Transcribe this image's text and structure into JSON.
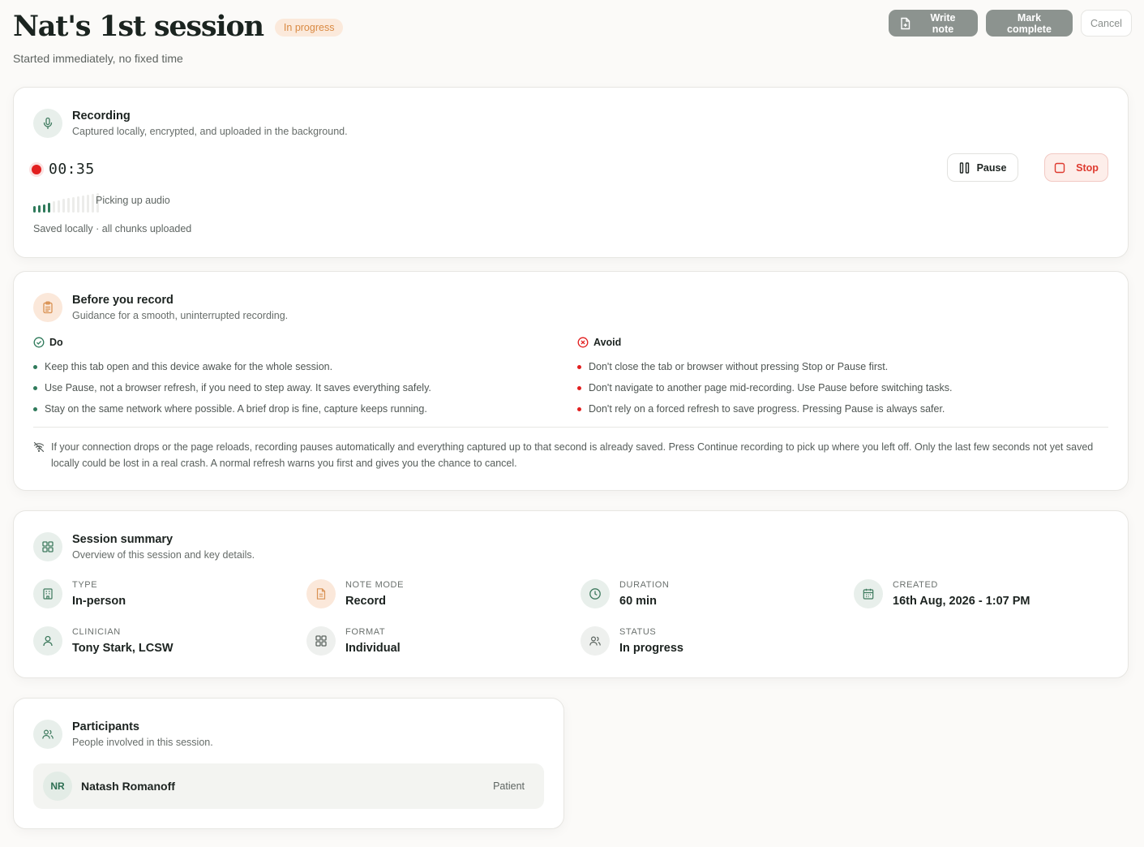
{
  "header": {
    "title": "Nat's 1st session",
    "status": "In progress",
    "subtitle": "Started immediately, no fixed time",
    "write_note": "Write note",
    "mark_complete": "Mark complete",
    "cancel": "Cancel"
  },
  "recording": {
    "title": "Recording",
    "subtitle": "Captured locally, encrypted, and uploaded in the background.",
    "time": "00:35",
    "level_label": "Picking up audio",
    "audio_level_bars_lit": 4,
    "audio_level_bars_total": 14,
    "saved_text": "Saved locally · all chunks uploaded",
    "pause": "Pause",
    "stop": "Stop"
  },
  "guidance": {
    "title": "Before you record",
    "subtitle": "Guidance for a smooth, uninterrupted recording.",
    "do_heading": "Do",
    "do_items": [
      "Keep this tab open and this device awake for the whole session.",
      "Use Pause, not a browser refresh, if you need to step away. It saves everything safely.",
      "Stay on the same network where possible. A brief drop is fine, capture keeps running."
    ],
    "avoid_heading": "Avoid",
    "avoid_items": [
      "Don't close the tab or browser without pressing Stop or Pause first.",
      "Don't navigate to another page mid-recording. Use Pause before switching tasks.",
      "Don't rely on a forced refresh to save progress. Pressing Pause is always safer."
    ],
    "note": "If your connection drops or the page reloads, recording pauses automatically and everything captured up to that second is already saved. Press Continue recording to pick up where you left off. Only the last few seconds not yet saved locally could be lost in a real crash. A normal refresh warns you first and gives you the chance to cancel."
  },
  "summary": {
    "title": "Session summary",
    "subtitle": "Overview of this session and key details.",
    "items": [
      {
        "label": "TYPE",
        "value": "In-person",
        "icon": "building-icon"
      },
      {
        "label": "NOTE MODE",
        "value": "Record",
        "icon": "document-icon"
      },
      {
        "label": "DURATION",
        "value": "60 min",
        "icon": "clock-icon"
      },
      {
        "label": "CREATED",
        "value": "16th Aug, 2026 - 1:07 PM",
        "icon": "calendar-icon"
      },
      {
        "label": "CLINICIAN",
        "value": "Tony Stark, LCSW",
        "icon": "user-icon"
      },
      {
        "label": "FORMAT",
        "value": "Individual",
        "icon": "grid-icon"
      },
      {
        "label": "STATUS",
        "value": "In progress",
        "icon": "users-icon"
      }
    ]
  },
  "participants": {
    "title": "Participants",
    "subtitle": "People involved in this session.",
    "list": [
      {
        "initials": "NR",
        "name": "Natash Romanoff",
        "role": "Patient"
      }
    ]
  },
  "colors": {
    "accent_green": "#2f7a5b",
    "record_red": "#e21f1f",
    "pill_orange": "#d98a43",
    "dark_button": "#8c938f"
  }
}
